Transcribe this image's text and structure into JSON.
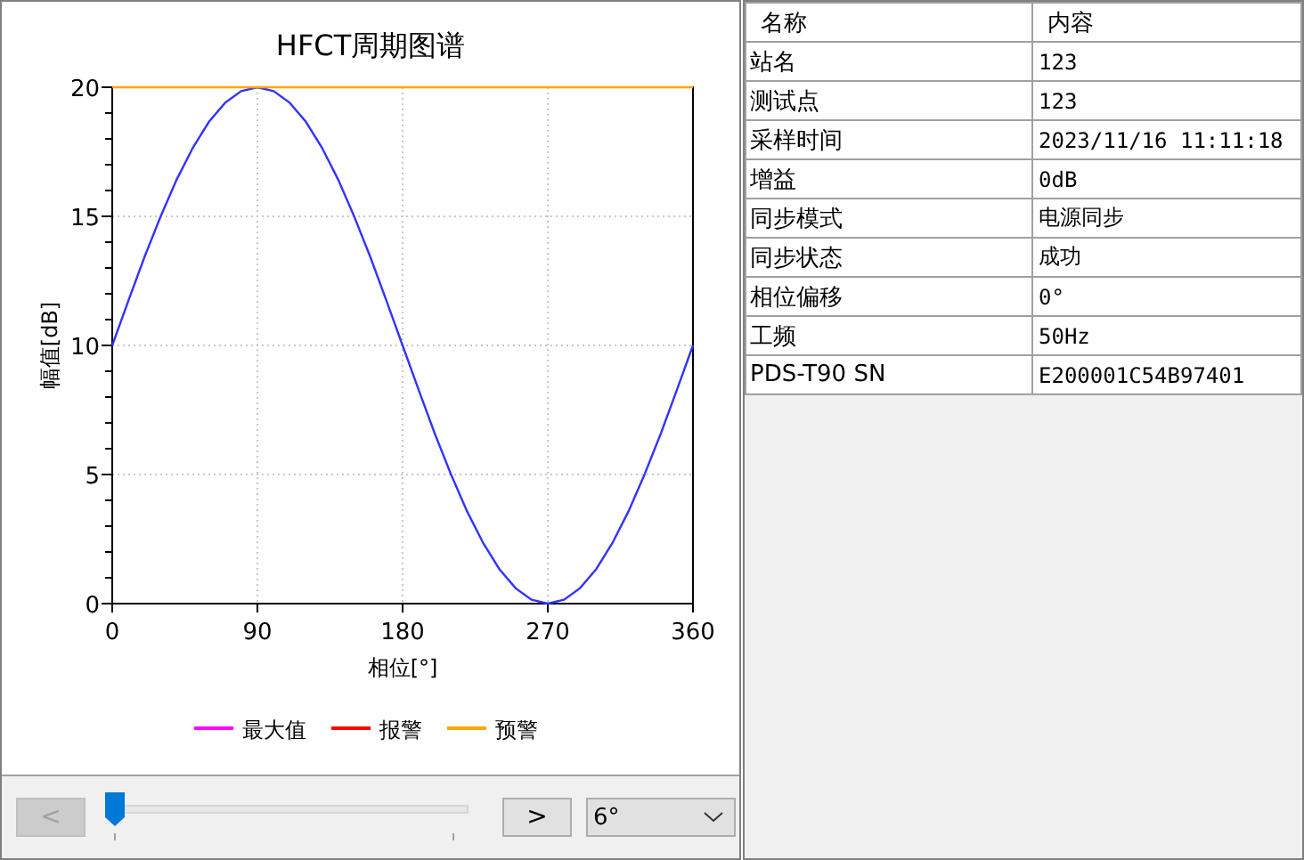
{
  "chart": {
    "chart_data": {
      "type": "line",
      "title": "HFCT周期图谱",
      "xlabel": "相位[°]",
      "ylabel": "幅值[dB]",
      "xlim": [
        0,
        360
      ],
      "ylim": [
        0,
        20
      ],
      "xticks": [
        0,
        90,
        180,
        270,
        360
      ],
      "yticks": [
        0,
        5,
        10,
        15,
        20
      ],
      "grid": true,
      "x": [
        0,
        10,
        20,
        30,
        40,
        50,
        60,
        70,
        80,
        90,
        100,
        110,
        120,
        130,
        140,
        150,
        160,
        170,
        180,
        190,
        200,
        210,
        220,
        230,
        240,
        250,
        260,
        270,
        280,
        290,
        300,
        310,
        320,
        330,
        340,
        350,
        360
      ],
      "series": [
        {
          "color": "#3333ff",
          "values": [
            10,
            11.74,
            13.42,
            15,
            16.43,
            17.66,
            18.66,
            19.4,
            19.85,
            20,
            19.85,
            19.4,
            18.66,
            17.66,
            16.43,
            15,
            13.42,
            11.74,
            10,
            8.26,
            6.58,
            5,
            3.57,
            2.34,
            1.34,
            0.6,
            0.15,
            0,
            0.15,
            0.6,
            1.34,
            2.34,
            3.57,
            5,
            6.58,
            8.26,
            10
          ]
        },
        {
          "name": "最大值",
          "color": "#ff00ff",
          "values": [
            null,
            null,
            null,
            null,
            null,
            null,
            null,
            null,
            null,
            null,
            null,
            null,
            null,
            null,
            null,
            null,
            null,
            null,
            null,
            null,
            null,
            null,
            null,
            null,
            null,
            null,
            null,
            null,
            null,
            null,
            null,
            null,
            null,
            null,
            null,
            null,
            null
          ]
        },
        {
          "name": "报警",
          "color": "#ff0000",
          "values": [
            null,
            null,
            null,
            null,
            null,
            null,
            null,
            null,
            null,
            null,
            null,
            null,
            null,
            null,
            null,
            null,
            null,
            null,
            null,
            null,
            null,
            null,
            null,
            null,
            null,
            null,
            null,
            null,
            null,
            null,
            null,
            null,
            null,
            null,
            null,
            null,
            null
          ]
        },
        {
          "name": "预警",
          "color": "#ffa500",
          "values": [
            20,
            20,
            20,
            20,
            20,
            20,
            20,
            20,
            20,
            20,
            20,
            20,
            20,
            20,
            20,
            20,
            20,
            20,
            20,
            20,
            20,
            20,
            20,
            20,
            20,
            20,
            20,
            20,
            20,
            20,
            20,
            20,
            20,
            20,
            20,
            20,
            20
          ]
        }
      ]
    }
  },
  "controls": {
    "prev": {
      "label": "<",
      "disabled": true
    },
    "slider": {
      "level": 0
    },
    "next": {
      "label": ">",
      "disabled": false
    },
    "step_select": {
      "value": "6°"
    }
  },
  "table": {
    "columns": [
      "名称",
      "内容"
    ],
    "rows": [
      [
        "站名",
        "123"
      ],
      [
        "测试点",
        "123"
      ],
      [
        "采样时间",
        "2023/11/16 11:11:18"
      ],
      [
        "增益",
        "0dB"
      ],
      [
        "同步模式",
        "电源同步"
      ],
      [
        "同步状态",
        "成功"
      ],
      [
        "相位偏移",
        "0°"
      ],
      [
        "工频",
        "50Hz"
      ],
      [
        "PDS-T90 SN",
        "E200001C54B97401"
      ]
    ]
  }
}
